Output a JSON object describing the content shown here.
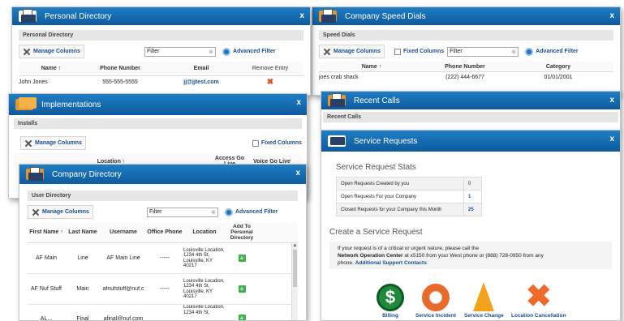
{
  "personal": {
    "title": "Personal Directory",
    "section": "Personal Directory",
    "manage": "Manage Columns",
    "filter": "Filter",
    "advanced": "Advanced Filter",
    "cols": [
      "Name ↑",
      "Phone Number",
      "Email",
      "Remove Entry"
    ],
    "rows": [
      {
        "name": "John Jones",
        "phone": "555-555-5555",
        "email": "jj@jjtest.com"
      }
    ]
  },
  "speed": {
    "title": "Company Speed Dials",
    "section": "Speed Dials",
    "manage": "Manage Columns",
    "fixed": "Fixed Columns",
    "filter": "Filter",
    "advanced": "Advanced Filter",
    "cols": [
      "Name ↑",
      "Phone Number",
      "Category"
    ],
    "rows": [
      {
        "name": "joes crab shack",
        "phone": "(222) 444-6677",
        "category": "01/01/2001"
      }
    ]
  },
  "impl": {
    "title": "Implementations",
    "section": "Installs",
    "manage": "Manage Columns",
    "fixed": "Fixed Columns",
    "cols": [
      "Location ↑",
      "Access Go Live",
      "Voice Go Live"
    ]
  },
  "recent": {
    "title": "Recent Calls",
    "section": "Recent Calls"
  },
  "company": {
    "title": "Company Directory",
    "section": "User Directory",
    "manage": "Manage Columns",
    "filter": "Filter",
    "advanced": "Advanced Filter",
    "cols": [
      "First Name ↑",
      "Last Name",
      "Username",
      "Office Phone",
      "Location",
      "Add To Personal Directory"
    ],
    "rows": [
      {
        "first": "AF Main",
        "last": "Line",
        "user": "AF Main Line",
        "phone": "-----",
        "loc": "Louisville Location, 1234 4th St, Louisville, KY 40217"
      },
      {
        "first": "AF Nuf Stuff",
        "last": "Main",
        "user": "afnufstuff@nuf.c",
        "phone": "-----",
        "loc": "Louisville Location, 1234 4th St, Louisville, KY 40217"
      },
      {
        "first": "AL...",
        "last": "Final",
        "user": "afinal@nuf.com",
        "phone": "",
        "loc": "Louisville Location, 1234 4th St,"
      }
    ]
  },
  "service": {
    "title": "Service Requests",
    "stats_title": "Service Request Stats",
    "stats": [
      {
        "label": "Open Requests Created by you",
        "value": "0"
      },
      {
        "label": "Open Requests For your Company",
        "value": "1"
      },
      {
        "label": "Closed Requests for your Company this Month",
        "value": "25"
      }
    ],
    "create_title": "Create a Service Request",
    "note_a": "If your request is of a critical or urgent nature, please call the",
    "note_b": "Network Operation Center",
    "note_c": " at x5150 from your West phone or (888) 728-0950 from any",
    "note_d": "phone.",
    "note_link": "Additional Support Contacts",
    "actions": [
      "Billing",
      "Service Incident",
      "Service Change",
      "Location Cancellation"
    ]
  },
  "close": "x",
  "colors": {
    "titlebar": "#1370b8",
    "link": "#1a4f8f",
    "accent": "#e8932b"
  }
}
